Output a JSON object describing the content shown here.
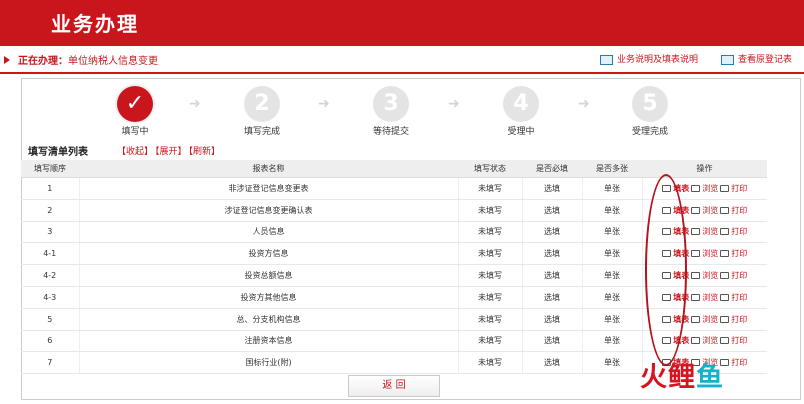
{
  "header": {
    "title": "业务办理"
  },
  "status": {
    "label": "正在办理：",
    "value": "单位纳税人信息变更"
  },
  "toolbar": {
    "guide": "业务说明及填表说明",
    "record": "查看原登记表"
  },
  "steps": [
    {
      "number": "✓",
      "label": "填写中"
    },
    {
      "number": "2",
      "label": "填写完成"
    },
    {
      "number": "3",
      "label": "等待提交"
    },
    {
      "number": "4",
      "label": "受理中"
    },
    {
      "number": "5",
      "label": "受理完成"
    }
  ],
  "list": {
    "title": "填写清单列表",
    "actions": [
      "【收起】",
      "【展开】",
      "【刷新】"
    ]
  },
  "table": {
    "headers": [
      "填写顺序",
      "报表名称",
      "填写状态",
      "是否必填",
      "是否多张",
      "操作"
    ],
    "rows": [
      [
        "1",
        "非涉证登记信息变更表",
        "未填写",
        "选填",
        "单张"
      ],
      [
        "2",
        "涉证登记信息变更确认表",
        "未填写",
        "选填",
        "单张"
      ],
      [
        "3",
        "人员信息",
        "未填写",
        "选填",
        "单张"
      ],
      [
        "4-1",
        "投资方信息",
        "未填写",
        "选填",
        "单张"
      ],
      [
        "4-2",
        "投资总额信息",
        "未填写",
        "选填",
        "单张"
      ],
      [
        "4-3",
        "投资方其他信息",
        "未填写",
        "选填",
        "单张"
      ],
      [
        "5",
        "总、分支机构信息",
        "未填写",
        "选填",
        "单张"
      ],
      [
        "6",
        "注册资本信息",
        "未填写",
        "选填",
        "单张"
      ],
      [
        "7",
        "国标行业(附)",
        "未填写",
        "选填",
        "单张"
      ]
    ],
    "ops": {
      "fill": "填表",
      "browse": "浏览",
      "print": "打印"
    }
  },
  "return": "返 回",
  "watermark": {
    "main": "鲤",
    "tail": "鱼"
  }
}
